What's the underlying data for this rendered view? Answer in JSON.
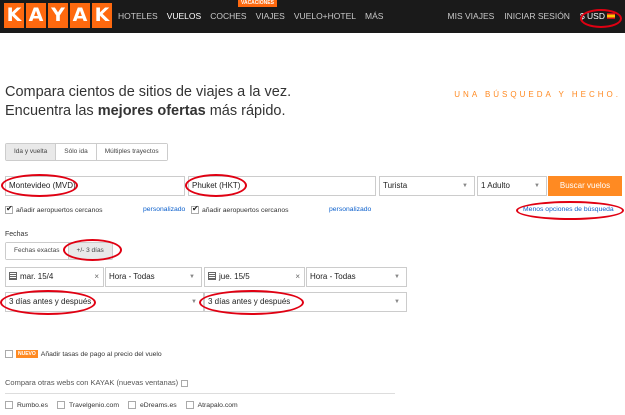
{
  "header": {
    "logo_letters": [
      "K",
      "A",
      "Y",
      "A",
      "K"
    ],
    "nav": [
      {
        "label": "HOTELES",
        "active": false
      },
      {
        "label": "VUELOS",
        "active": true
      },
      {
        "label": "COCHES",
        "active": false
      },
      {
        "label": "VIAJES",
        "active": false
      },
      {
        "label": "VUELO+HOTEL",
        "active": false
      },
      {
        "label": "MÁS",
        "active": false
      }
    ],
    "vacaciones_badge": "VACACIONES",
    "mis_viajes": "MIS VIAJES",
    "iniciar_sesion": "INICIAR SESIÓN",
    "currency": "$ USD"
  },
  "hero": {
    "line1": "Compara cientos de sitios de viajes a la vez.",
    "line2_pre": "Encuentra las ",
    "line2_bold": "mejores ofertas",
    "line2_post": " más rápido.",
    "tagline": "UNA BÚSQUEDA Y HECHO."
  },
  "trip_tabs": [
    {
      "label": "Ida y vuelta",
      "active": true
    },
    {
      "label": "Sólo ida",
      "active": false
    },
    {
      "label": "Múltiples trayectos",
      "active": false
    }
  ],
  "search": {
    "origin": "Montevideo (MVD)",
    "destination": "Phuket (HKT)",
    "cabin": "Turista",
    "travelers": "1 Adulto",
    "submit": "Buscar vuelos"
  },
  "options": {
    "nearby_origin": "añadir aeropuertos cercanos",
    "personalizado_1": "personalizado",
    "nearby_dest": "añadir aeropuertos cercanos",
    "personalizado_2": "personalizado",
    "menos_opciones": "Menos opciones de búsqueda"
  },
  "dates": {
    "label": "Fechas",
    "tabs": [
      {
        "label": "Fechas exactas",
        "active": false
      },
      {
        "label": "+/- 3 días",
        "active": true
      }
    ],
    "depart_date": "mar. 15/4",
    "depart_time": "Hora - Todas",
    "return_date": "jue. 15/5",
    "return_time": "Hora - Todas",
    "depart_flex": "3 días antes y después",
    "return_flex": "3 días antes y después"
  },
  "fees": {
    "badge": "NUEVO",
    "text": "Añadir tasas de pago al precio del vuelo"
  },
  "compare": {
    "title": "Compara otras webs con KAYAK (nuevas ventanas)",
    "sites": [
      "Rumbo.es",
      "Travelgenio.com",
      "eDreams.es",
      "Atrapalo.com"
    ]
  },
  "colors": {
    "brand_orange": "#ff690f",
    "button_orange": "#ff8a22",
    "annotation_red": "#e00012",
    "link_blue": "#0b5fcc"
  }
}
